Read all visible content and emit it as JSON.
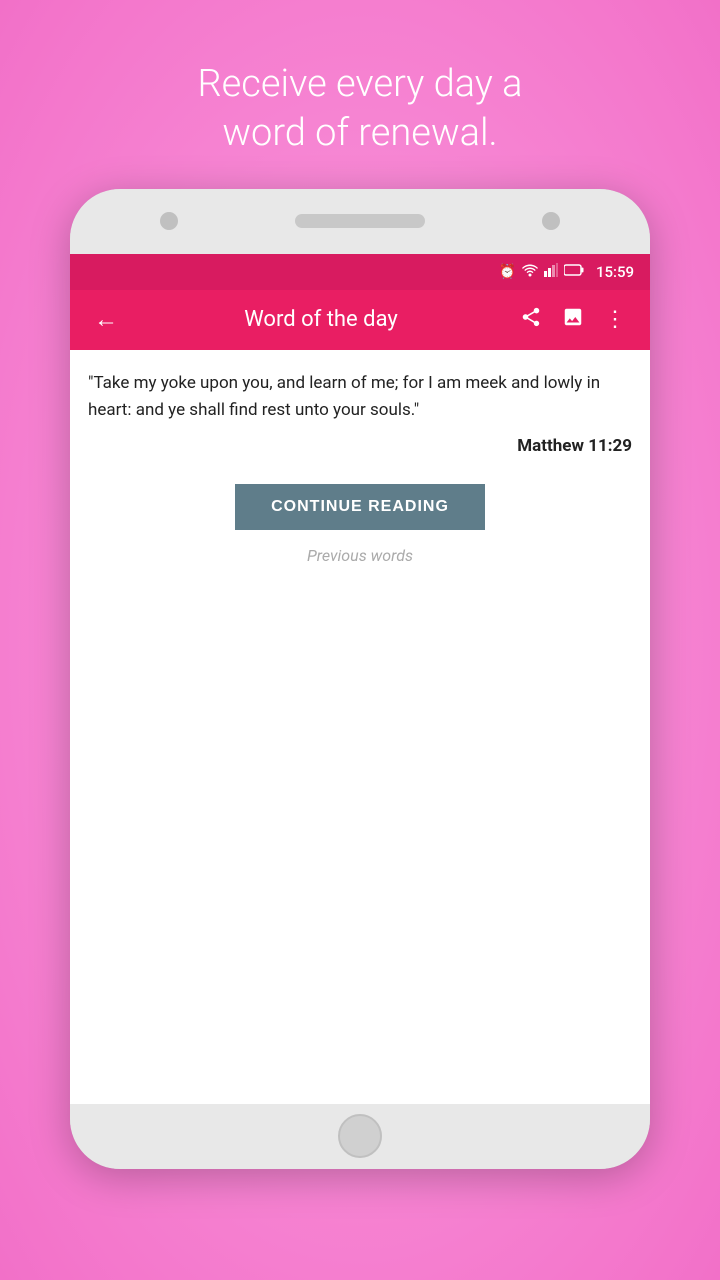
{
  "background": {
    "color": "#f97fd8"
  },
  "tagline": {
    "line1": "Receive every day a",
    "line2": "word of renewal."
  },
  "status_bar": {
    "time": "15:59",
    "icons": {
      "alarm": "⏰",
      "wifi": "▲",
      "signal": "▲",
      "battery": "🔋"
    }
  },
  "app_bar": {
    "title": "Word of the day",
    "back_icon": "←",
    "share_icon": "⇧",
    "image_icon": "🖼",
    "more_icon": "⋮"
  },
  "content": {
    "quote": "\"Take my yoke upon you, and learn of me; for I am meek and lowly in heart: and ye shall find rest unto your souls.\"",
    "reference": "Matthew 11:29",
    "continue_button": "CONTINUE READING",
    "previous_words": "Previous words"
  }
}
